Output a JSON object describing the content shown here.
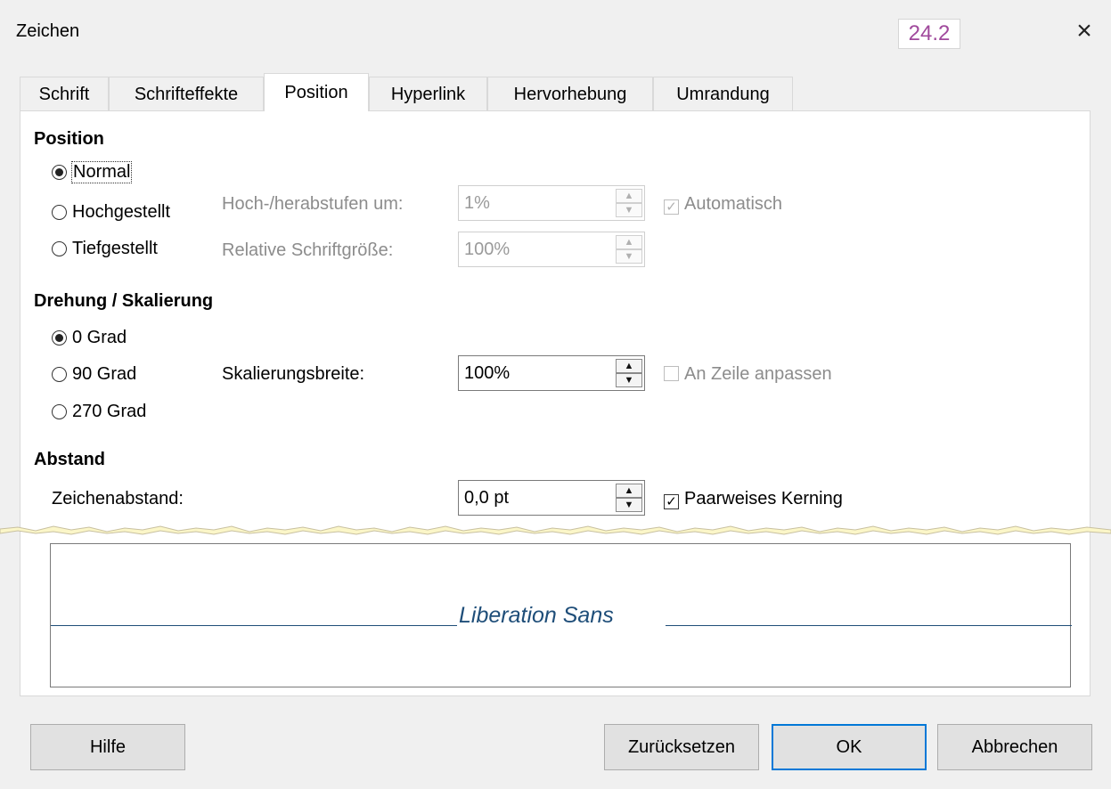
{
  "window": {
    "title": "Zeichen",
    "version_badge": "24.2",
    "close_label": "×"
  },
  "tabs": [
    {
      "label": "Schrift"
    },
    {
      "label": "Schrifteffekte"
    },
    {
      "label": "Position"
    },
    {
      "label": "Hyperlink"
    },
    {
      "label": "Hervorhebung"
    },
    {
      "label": "Umrandung"
    }
  ],
  "active_tab": "Position",
  "position": {
    "heading": "Position",
    "normal": "Normal",
    "hochgestellt": "Hochgestellt",
    "tiefgestellt": "Tiefgestellt",
    "selected": "Normal",
    "raise_label": "Hoch-/herabstufen um:",
    "raise_value": "1%",
    "automatic_label": "Automatisch",
    "automatic_checked": true,
    "relsize_label": "Relative Schriftgröße:",
    "relsize_value": "100%"
  },
  "rotation": {
    "heading": "Drehung / Skalierung",
    "deg0": "0 Grad",
    "deg90": "90 Grad",
    "deg270": "270 Grad",
    "selected": "0 Grad",
    "scale_label": "Skalierungsbreite:",
    "scale_value": "100%",
    "fit_line_label": "An Zeile anpassen",
    "fit_line_checked": false
  },
  "spacing": {
    "heading": "Abstand",
    "char_spacing_label": "Zeichenabstand:",
    "char_spacing_value": "0,0 pt",
    "kerning_label": "Paarweises Kerning",
    "kerning_checked": true
  },
  "preview": {
    "text": "Liberation Sans"
  },
  "buttons": {
    "help": "Hilfe",
    "reset": "Zurücksetzen",
    "ok": "OK",
    "cancel": "Abbrechen"
  },
  "colors": {
    "accent": "#0078d7",
    "preview_text": "#1f4e79",
    "version": "#a04a9c"
  }
}
